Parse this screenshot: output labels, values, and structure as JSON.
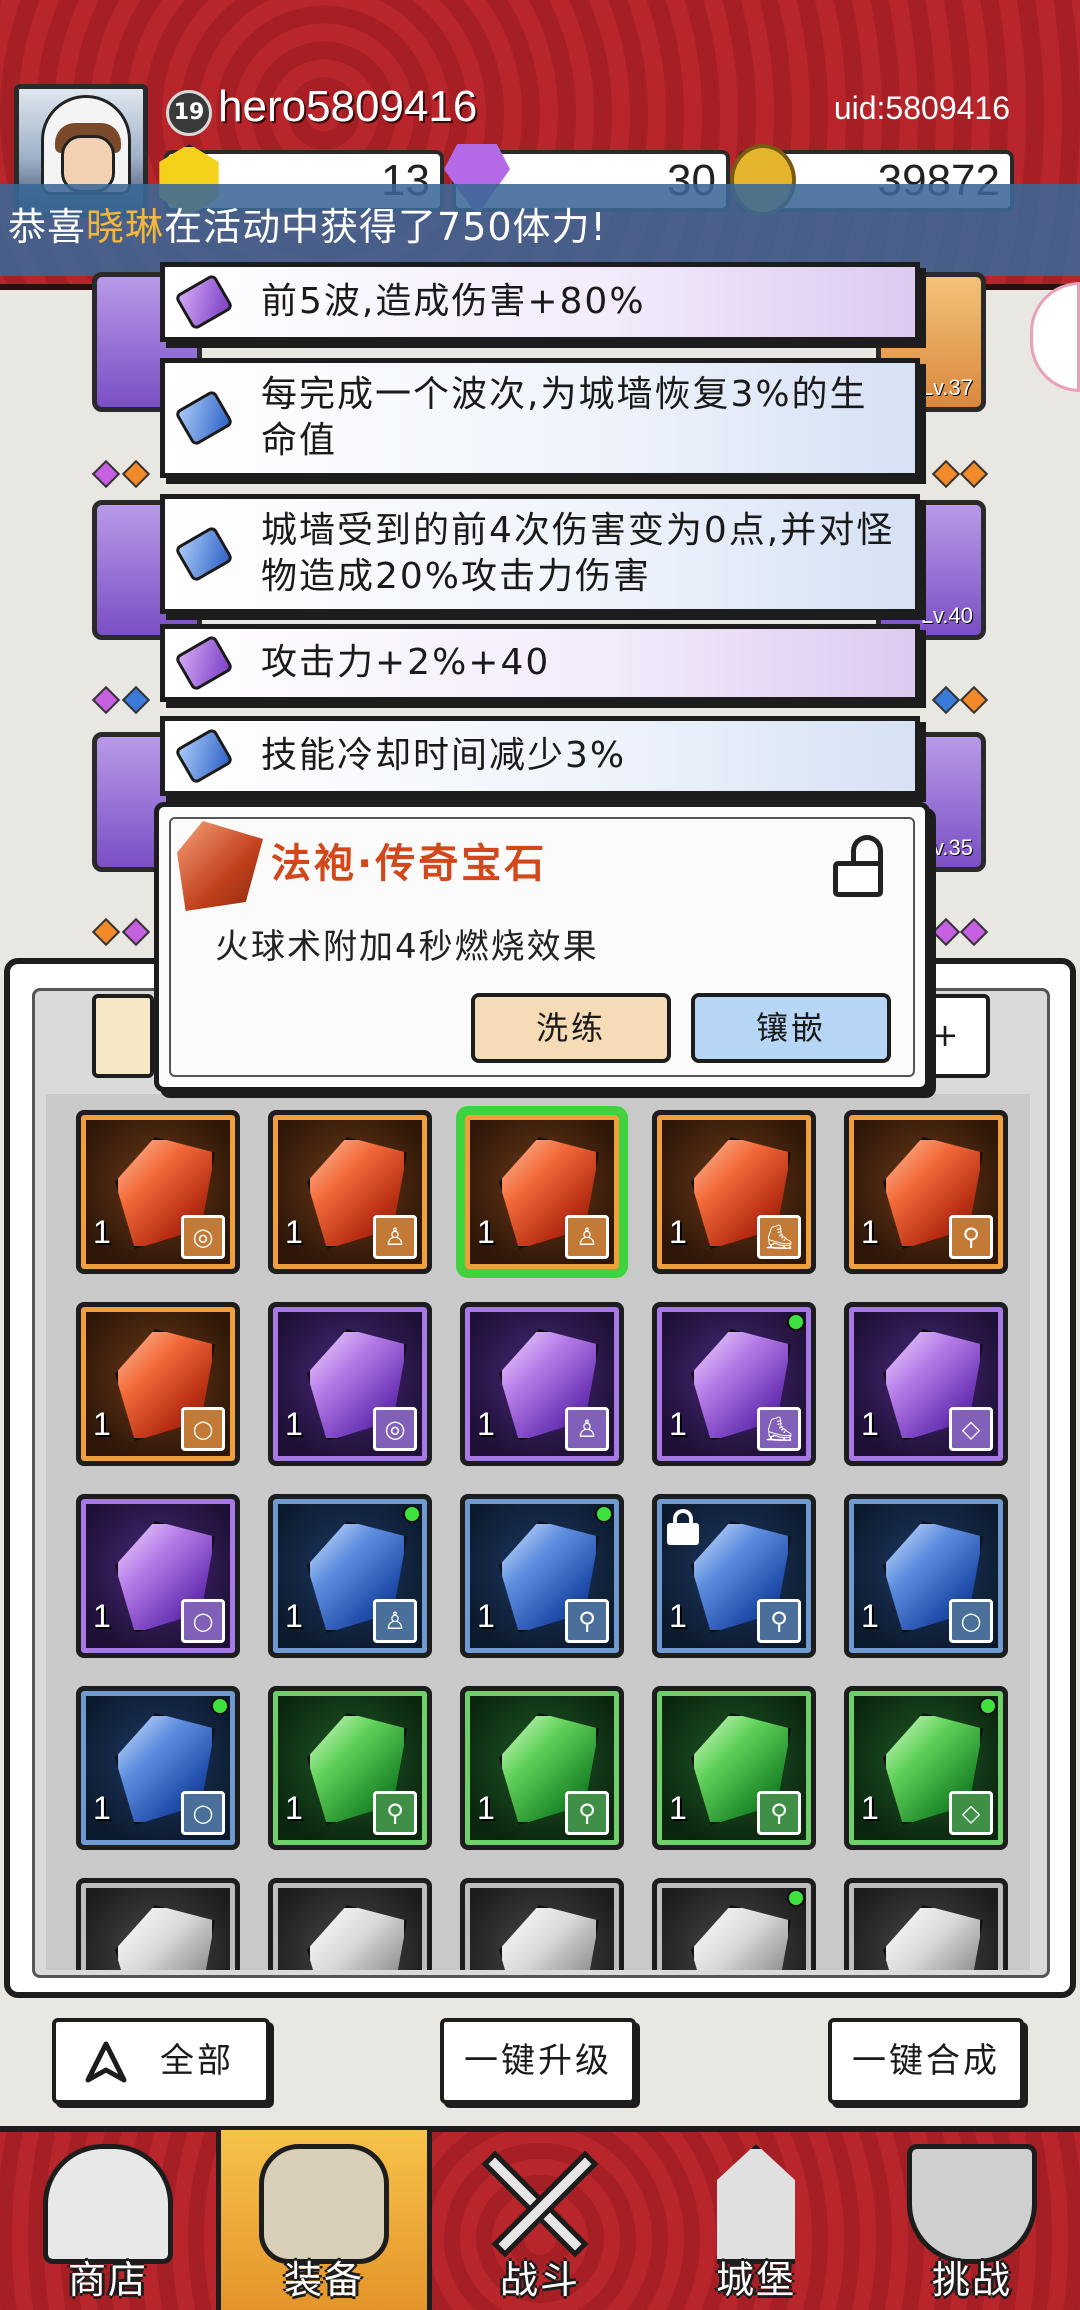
{
  "profile": {
    "level": "19",
    "username": "hero5809416",
    "uid": "uid:5809416"
  },
  "currency": {
    "energy": "13",
    "gems": "30",
    "gold": "39872"
  },
  "announcement": {
    "prefix": "恭喜",
    "player": "晓琳",
    "suffix": "在活动中获得了750体力!"
  },
  "equipment_levels": {
    "right_1": "Lv.37",
    "right_2": "Lv.40",
    "right_3": "Lv.35"
  },
  "stats": [
    {
      "text": "前5波,造成伤害+80%",
      "gem": "purple"
    },
    {
      "text": "每完成一个波次,为城墙恢复3%的生命值",
      "gem": "blue"
    },
    {
      "text": "城墙受到的前4次伤害变为0点,并对怪物造成20%攻击力伤害",
      "gem": "blue"
    },
    {
      "text": "攻击力+2%+40",
      "gem": "purple"
    },
    {
      "text": "技能冷却时间减少3%",
      "gem": "blue"
    }
  ],
  "gem_popup": {
    "title": "法袍·传奇宝石",
    "description": "火球术附加4秒燃烧效果",
    "reforge_label": "洗练",
    "inlay_label": "镶嵌"
  },
  "inventory": {
    "filter_right_label": "+",
    "rows": [
      [
        {
          "color": "orange",
          "count": "1",
          "type": "◎",
          "dot": false,
          "lock": false,
          "selected": false
        },
        {
          "color": "orange",
          "count": "1",
          "type": "♙",
          "dot": false,
          "lock": false,
          "selected": false
        },
        {
          "color": "orange",
          "count": "1",
          "type": "♙",
          "dot": false,
          "lock": false,
          "selected": true
        },
        {
          "color": "orange",
          "count": "1",
          "type": "⛸",
          "dot": false,
          "lock": false,
          "selected": false
        },
        {
          "color": "orange",
          "count": "1",
          "type": "⚲",
          "dot": false,
          "lock": false,
          "selected": false
        }
      ],
      [
        {
          "color": "orange",
          "count": "1",
          "type": "○",
          "dot": false,
          "lock": false,
          "selected": false
        },
        {
          "color": "purple",
          "count": "1",
          "type": "◎",
          "dot": false,
          "lock": false,
          "selected": false
        },
        {
          "color": "purple",
          "count": "1",
          "type": "♙",
          "dot": false,
          "lock": false,
          "selected": false
        },
        {
          "color": "purple",
          "count": "1",
          "type": "⛸",
          "dot": true,
          "lock": false,
          "selected": false
        },
        {
          "color": "purple",
          "count": "1",
          "type": "◇",
          "dot": false,
          "lock": false,
          "selected": false
        }
      ],
      [
        {
          "color": "purple",
          "count": "1",
          "type": "○",
          "dot": false,
          "lock": false,
          "selected": false
        },
        {
          "color": "blue",
          "count": "1",
          "type": "♙",
          "dot": true,
          "lock": false,
          "selected": false
        },
        {
          "color": "blue",
          "count": "1",
          "type": "⚲",
          "dot": true,
          "lock": false,
          "selected": false
        },
        {
          "color": "blue",
          "count": "1",
          "type": "⚲",
          "dot": false,
          "lock": true,
          "selected": false
        },
        {
          "color": "blue",
          "count": "1",
          "type": "○",
          "dot": false,
          "lock": false,
          "selected": false
        }
      ],
      [
        {
          "color": "blue",
          "count": "1",
          "type": "○",
          "dot": true,
          "lock": false,
          "selected": false
        },
        {
          "color": "green",
          "count": "1",
          "type": "⚲",
          "dot": false,
          "lock": false,
          "selected": false
        },
        {
          "color": "green",
          "count": "1",
          "type": "⚲",
          "dot": false,
          "lock": false,
          "selected": false
        },
        {
          "color": "green",
          "count": "1",
          "type": "⚲",
          "dot": false,
          "lock": false,
          "selected": false
        },
        {
          "color": "green",
          "count": "1",
          "type": "◇",
          "dot": true,
          "lock": false,
          "selected": false
        }
      ],
      [
        {
          "color": "gray",
          "count": "",
          "type": "",
          "dot": false,
          "lock": false,
          "selected": false
        },
        {
          "color": "gray",
          "count": "",
          "type": "",
          "dot": false,
          "lock": false,
          "selected": false
        },
        {
          "color": "gray",
          "count": "",
          "type": "",
          "dot": false,
          "lock": false,
          "selected": false
        },
        {
          "color": "gray",
          "count": "",
          "type": "",
          "dot": true,
          "lock": false,
          "selected": false
        },
        {
          "color": "gray",
          "count": "",
          "type": "",
          "dot": false,
          "lock": false,
          "selected": false
        }
      ]
    ]
  },
  "actions": {
    "all_label": "全部",
    "upgrade_label": "一键升级",
    "merge_label": "一键合成"
  },
  "nav": [
    {
      "label": "商店",
      "icon": "shop-icon"
    },
    {
      "label": "装备",
      "icon": "backpack-icon"
    },
    {
      "label": "战斗",
      "icon": "crossed-swords-icon"
    },
    {
      "label": "城堡",
      "icon": "castle-icon"
    },
    {
      "label": "挑战",
      "icon": "shield-icon"
    }
  ],
  "colors": {
    "banner_red": "#b8262b",
    "announce_blue": "#3a6896",
    "highlight_orange": "#f3b63a",
    "legendary_title": "#d2481a",
    "selected_green": "#3fd23f"
  }
}
